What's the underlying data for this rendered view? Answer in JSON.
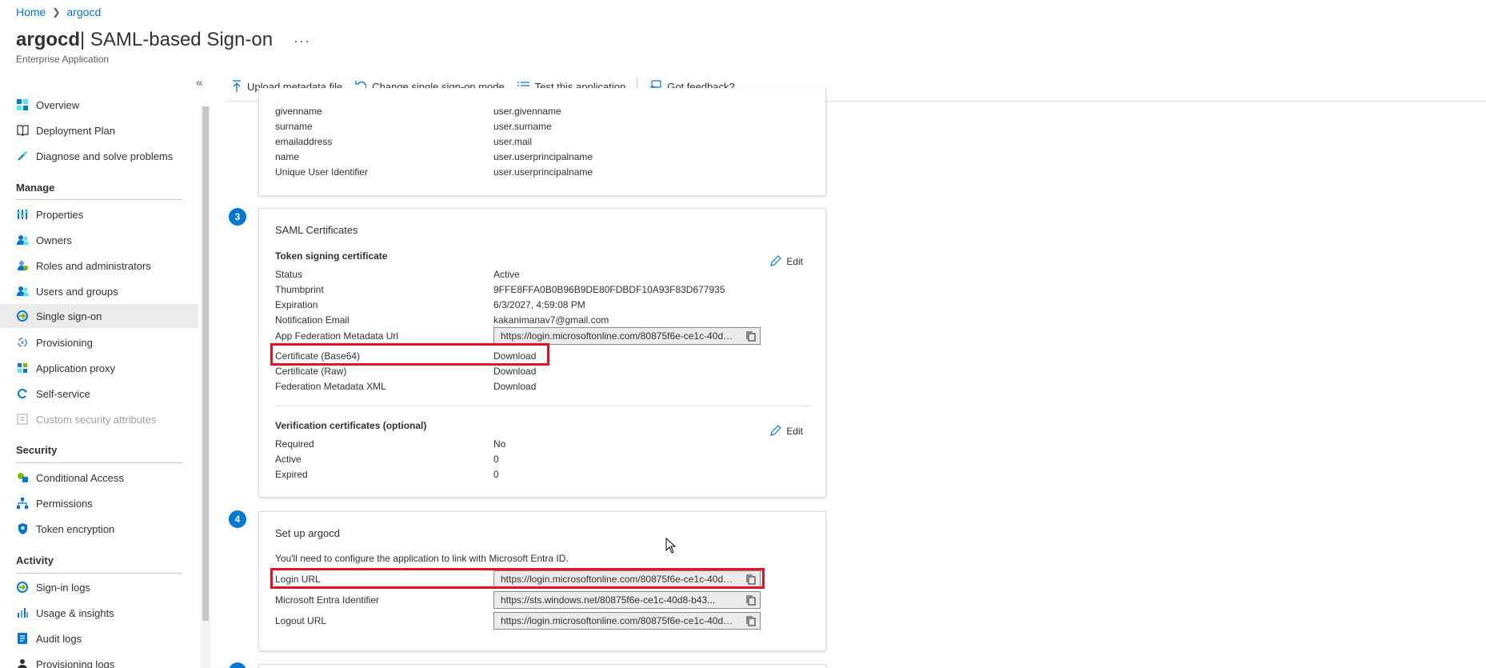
{
  "header": {
    "breadcrumb": [
      "Home",
      "argocd"
    ],
    "app_name": "argocd",
    "title_rest": " | SAML-based Sign-on",
    "more_label": "···",
    "subtitle": "Enterprise Application"
  },
  "sidebar": {
    "collapse_label": "«",
    "items_top": [
      {
        "label": "Overview",
        "icon": "grid-icon"
      },
      {
        "label": "Deployment Plan",
        "icon": "book-icon"
      },
      {
        "label": "Diagnose and solve problems",
        "icon": "wrench-icon"
      }
    ],
    "sections": [
      {
        "title": "Manage",
        "items": [
          {
            "label": "Properties",
            "icon": "properties-icon"
          },
          {
            "label": "Owners",
            "icon": "owners-icon"
          },
          {
            "label": "Roles and administrators",
            "icon": "roles-icon"
          },
          {
            "label": "Users and groups",
            "icon": "users-icon"
          },
          {
            "label": "Single sign-on",
            "icon": "sso-icon",
            "active": true
          },
          {
            "label": "Provisioning",
            "icon": "provisioning-icon"
          },
          {
            "label": "Application proxy",
            "icon": "proxy-icon"
          },
          {
            "label": "Self-service",
            "icon": "self-service-icon"
          },
          {
            "label": "Custom security attributes",
            "icon": "attributes-icon",
            "disabled": true
          }
        ]
      },
      {
        "title": "Security",
        "items": [
          {
            "label": "Conditional Access",
            "icon": "conditional-access-icon"
          },
          {
            "label": "Permissions",
            "icon": "permissions-icon"
          },
          {
            "label": "Token encryption",
            "icon": "shield-icon"
          }
        ]
      },
      {
        "title": "Activity",
        "items": [
          {
            "label": "Sign-in logs",
            "icon": "sign-in-icon"
          },
          {
            "label": "Usage & insights",
            "icon": "chart-icon"
          },
          {
            "label": "Audit logs",
            "icon": "audit-icon"
          },
          {
            "label": "Provisioning logs",
            "icon": "person-icon"
          }
        ]
      }
    ]
  },
  "toolbar": {
    "upload": "Upload metadata file",
    "change": "Change single sign-on mode",
    "test": "Test this application",
    "feedback": "Got feedback?"
  },
  "attributes_card": {
    "rows": [
      {
        "k": "givenname",
        "v": "user.givenname"
      },
      {
        "k": "surname",
        "v": "user.surname"
      },
      {
        "k": "emailaddress",
        "v": "user.mail"
      },
      {
        "k": "name",
        "v": "user.userprincipalname"
      },
      {
        "k": "Unique User Identifier",
        "v": "user.userprincipalname"
      }
    ]
  },
  "certs_card": {
    "step": "3",
    "title": "SAML Certificates",
    "token_title": "Token signing certificate",
    "edit_label": "Edit",
    "status_k": "Status",
    "status_v": "Active",
    "thumb_k": "Thumbprint",
    "thumb_v": "9FFE8FFA0B0B96B9DE80FDBDF10A93F83D677935",
    "exp_k": "Expiration",
    "exp_v": "6/3/2027, 4:59:08 PM",
    "email_k": "Notification Email",
    "email_v": "kakanimanav7@gmail.com",
    "metadata_url_k": "App Federation Metadata Url",
    "metadata_url_v": "https://login.microsoftonline.com/80875f6e-ce1c-40d8-b43...",
    "cert64_k": "Certificate (Base64)",
    "cert64_v": "Download",
    "certraw_k": "Certificate (Raw)",
    "certraw_v": "Download",
    "fedxml_k": "Federation Metadata XML",
    "fedxml_v": "Download",
    "verif_title": "Verification certificates (optional)",
    "verif_edit": "Edit",
    "required_k": "Required",
    "required_v": "No",
    "active_k": "Active",
    "active_v": "0",
    "expired_k": "Expired",
    "expired_v": "0"
  },
  "setup_card": {
    "step": "4",
    "title": "Set up argocd",
    "description": "You'll need to configure the application to link with Microsoft Entra ID.",
    "login_k": "Login URL",
    "login_v": "https://login.microsoftonline.com/80875f6e-ce1c-40d8-b43...",
    "entra_k": "Microsoft Entra Identifier",
    "entra_v": "https://sts.windows.net/80875f6e-ce1c-40d8-b43...",
    "logout_k": "Logout URL",
    "logout_v": "https://login.microsoftonline.com/80875f6e-ce1c-40d8-b43..."
  },
  "colors": {
    "accent": "#0078d4",
    "highlight": "#e81123",
    "active_nav": "#edebe9"
  }
}
